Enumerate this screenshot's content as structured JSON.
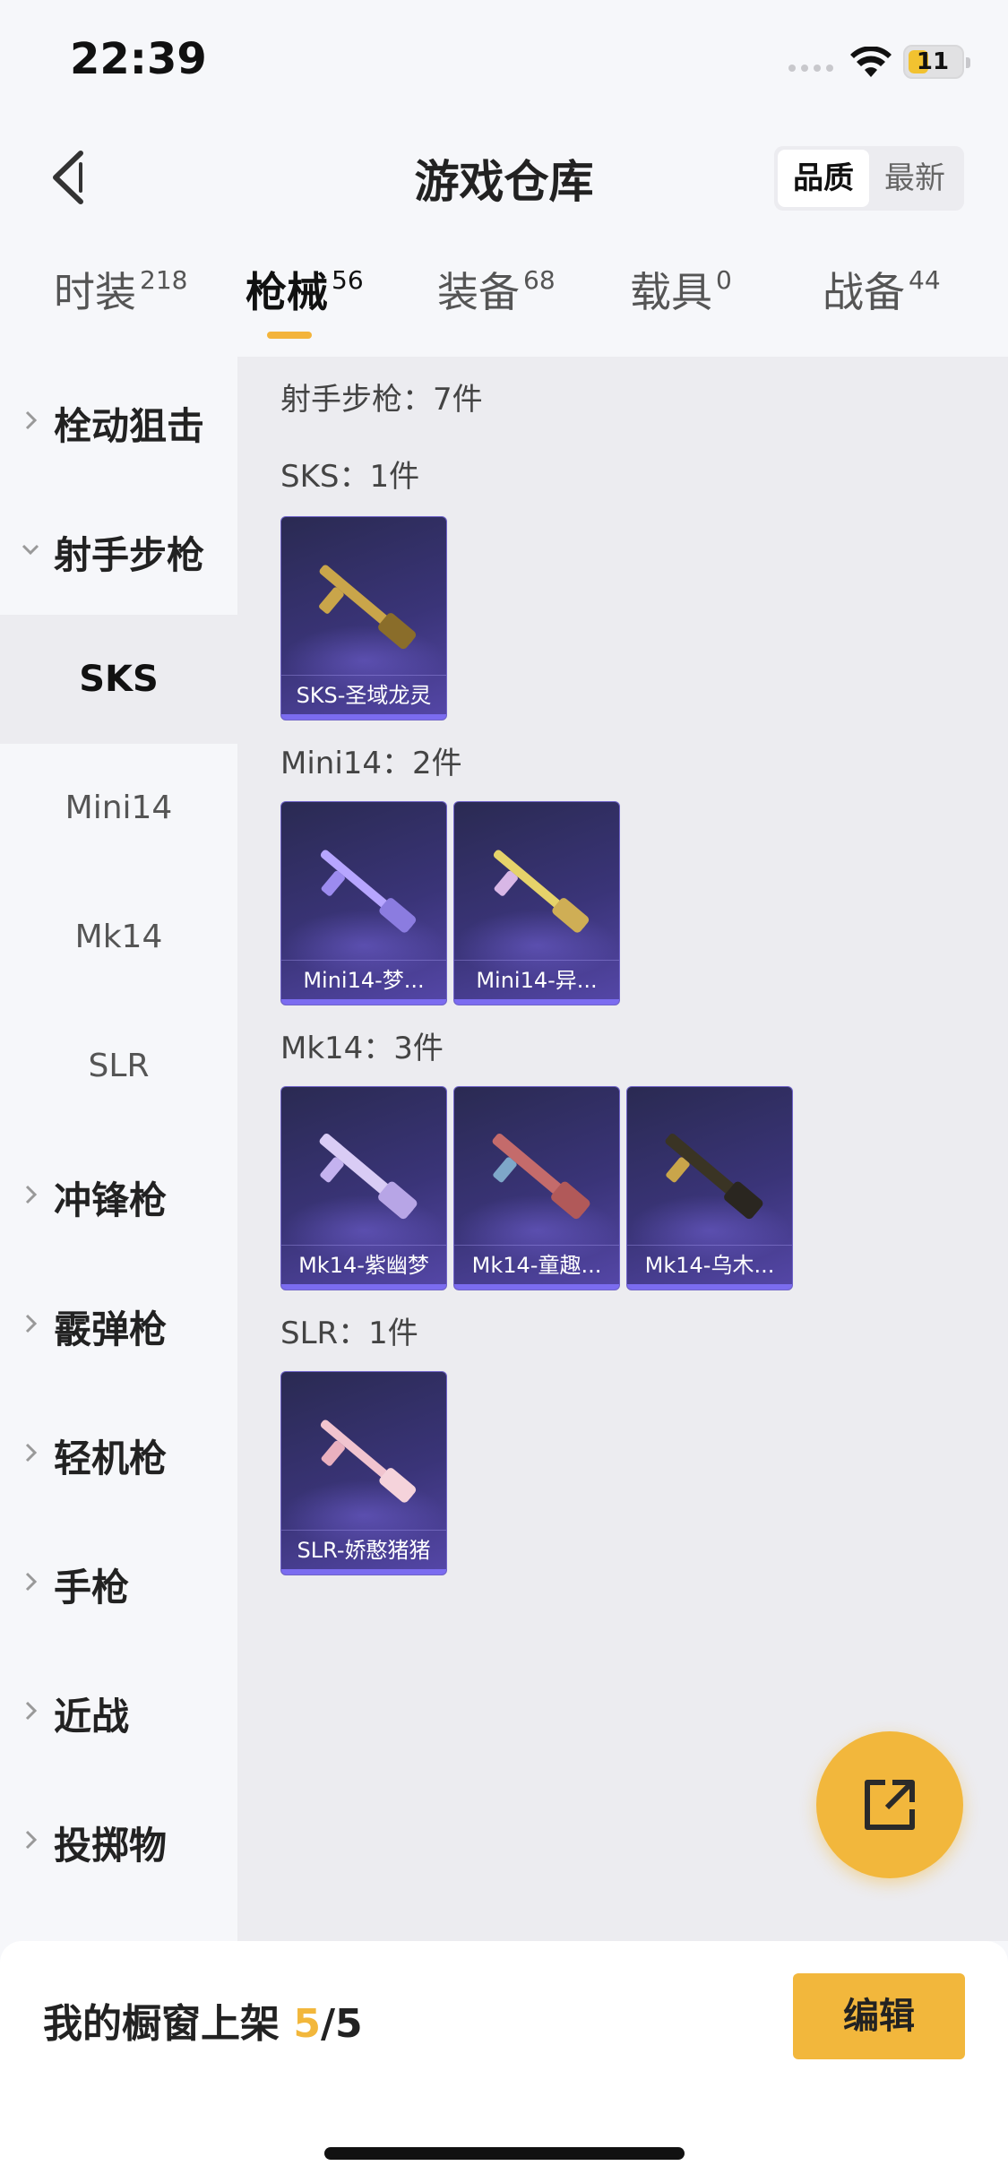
{
  "status_bar": {
    "time": "22:39",
    "battery": "11"
  },
  "header": {
    "title": "游戏仓库",
    "sort_options": [
      "品质",
      "最新"
    ],
    "sort_selected": "品质"
  },
  "tabs": [
    {
      "label": "时装",
      "count": "218"
    },
    {
      "label": "枪械",
      "count": "56",
      "active": true
    },
    {
      "label": "装备",
      "count": "68"
    },
    {
      "label": "载具",
      "count": "0"
    },
    {
      "label": "战备",
      "count": "44"
    }
  ],
  "sidebar": {
    "categories": [
      {
        "label": "栓动狙击",
        "expanded": false
      },
      {
        "label": "射手步枪",
        "expanded": true
      },
      {
        "label": "冲锋枪",
        "expanded": false
      },
      {
        "label": "霰弹枪",
        "expanded": false
      },
      {
        "label": "轻机枪",
        "expanded": false
      },
      {
        "label": "手枪",
        "expanded": false
      },
      {
        "label": "近战",
        "expanded": false
      },
      {
        "label": "投掷物",
        "expanded": false
      }
    ],
    "subitems": [
      "SKS",
      "Mini14",
      "Mk14",
      "SLR"
    ],
    "selected_subitem": "SKS"
  },
  "content": {
    "category_title": "射手步枪：7件",
    "groups": [
      {
        "title": "SKS：1件",
        "items": [
          "SKS-圣域龙灵"
        ]
      },
      {
        "title": "Mini14：2件",
        "items": [
          "Mini14-梦...",
          "Mini14-异..."
        ]
      },
      {
        "title": "Mk14：3件",
        "items": [
          "Mk14-紫幽梦",
          "Mk14-童趣...",
          "Mk14-乌木..."
        ]
      },
      {
        "title": "SLR：1件",
        "items": [
          "SLR-娇憨猪猪"
        ]
      }
    ]
  },
  "showcase": {
    "prefix": "我的橱窗上架 ",
    "current": "5",
    "suffix": "/5",
    "edit_label": "编辑"
  },
  "colors": {
    "accent": "#f2b73c",
    "card_bg": "#3a3478"
  }
}
